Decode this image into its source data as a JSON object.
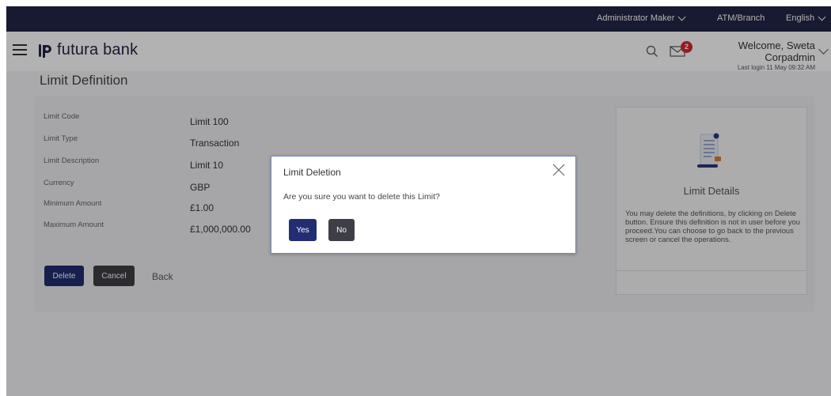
{
  "topbar": {
    "role": "Administrator Maker",
    "location": "ATM/Branch",
    "language": "English"
  },
  "header": {
    "brand": "futura bank",
    "notification_count": "2",
    "welcome": "Welcome, Sweta Corpadmin",
    "last_login": "Last login 11 May 09:32 AM"
  },
  "page": {
    "title": "Limit Definition"
  },
  "details": [
    {
      "label": "Limit Code",
      "value": "Limit 100"
    },
    {
      "label": "Limit Type",
      "value": "Transaction"
    },
    {
      "label": "Limit Description",
      "value": "Limit 10"
    },
    {
      "label": "Currency",
      "value": "GBP"
    },
    {
      "label": "Minimum Amount",
      "value": "£1.00"
    },
    {
      "label": "Maximum Amount",
      "value": "£1,000,000.00"
    }
  ],
  "actions": {
    "delete": "Delete",
    "cancel": "Cancel",
    "back": "Back"
  },
  "side_panel": {
    "title": "Limit Details",
    "text": "You may delete the definitions, by clicking on Delete button. Ensure this definition is not in user before you proceed.You can choose to go back to the previous screen or cancel the operations."
  },
  "modal": {
    "title": "Limit Deletion",
    "message": "Are you sure you want to delete this Limit?",
    "yes": "Yes",
    "no": "No"
  },
  "colors": {
    "topbar": "#222645",
    "primary_button": "#222d72",
    "dark_button": "#3e3e46",
    "badge": "#d9272e"
  }
}
